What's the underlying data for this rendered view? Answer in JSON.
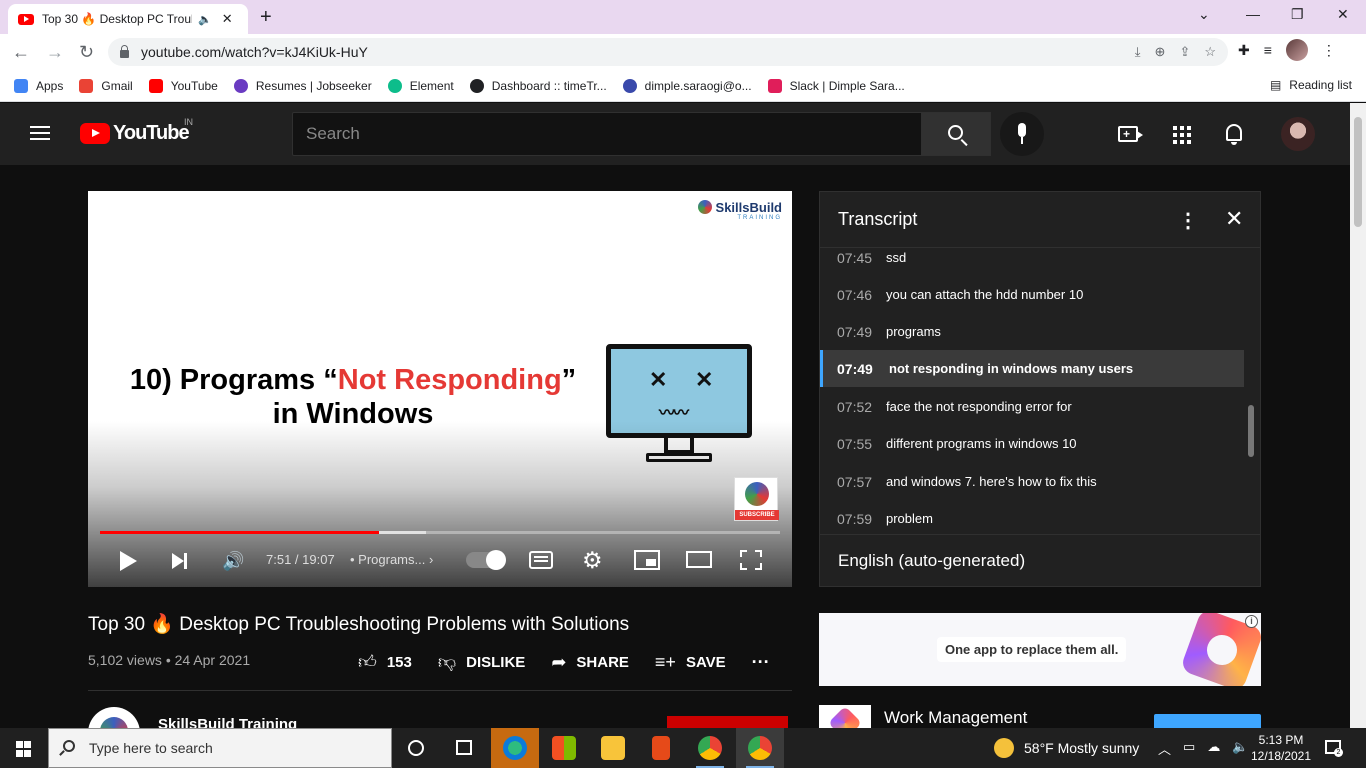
{
  "browser": {
    "tab_title": "Top 30 🔥 Desktop PC Troubl",
    "url": "youtube.com/watch?v=kJ4KiUk-HuY",
    "bookmarks": [
      {
        "label": "Apps",
        "color": "#4285f4"
      },
      {
        "label": "Gmail",
        "color": "#ea4335"
      },
      {
        "label": "YouTube",
        "color": "#ff0000"
      },
      {
        "label": "Resumes | Jobseeker",
        "color": "#6a3bc2"
      },
      {
        "label": "Element",
        "color": "#0dbd8b"
      },
      {
        "label": "Dashboard :: timeTr...",
        "color": "#202124"
      },
      {
        "label": "dimple.saraogi@o...",
        "color": "#3949ab"
      },
      {
        "label": "Slack | Dimple Sara...",
        "color": "#e01e5a"
      }
    ],
    "reading_list": "Reading list"
  },
  "youtube": {
    "logo_text": "YouTube",
    "country": "IN",
    "search_placeholder": "Search"
  },
  "player": {
    "brand_name": "SkillsBuild",
    "brand_sub": "TRAINING",
    "slide_prefix": "10)  Programs “",
    "slide_red": "Not Responding",
    "slide_suffix": "”",
    "slide_line2": "in Windows",
    "subscribe_label": "SUBSCRIBE",
    "time": "7:51 / 19:07",
    "chapter": "• Programs...",
    "progress_played": 0.41,
    "progress_loaded": 0.48
  },
  "video": {
    "title": "Top 30 🔥 Desktop PC Troubleshooting Problems with Solutions",
    "meta": "5,102 views • 24 Apr 2021",
    "likes": "153",
    "dislike": "DISLIKE",
    "share": "SHARE",
    "save": "SAVE",
    "channel": "SkillsBuild Training"
  },
  "transcript": {
    "title": "Transcript",
    "language": "English (auto-generated)",
    "segments": [
      {
        "time": "07:45",
        "text": "ssd"
      },
      {
        "time": "07:46",
        "text": "you can attach the hdd number 10"
      },
      {
        "time": "07:49",
        "text": "programs"
      },
      {
        "time": "07:49",
        "text": "not responding in windows many users"
      },
      {
        "time": "07:52",
        "text": "face the not responding error for"
      },
      {
        "time": "07:55",
        "text": "different programs in windows 10"
      },
      {
        "time": "07:57",
        "text": "and windows 7. here's how to fix this"
      },
      {
        "time": "07:59",
        "text": "problem"
      }
    ]
  },
  "ad": {
    "tagline": "One app to replace them all."
  },
  "related": {
    "title": "Work Management"
  },
  "taskbar": {
    "search_placeholder": "Type here to search",
    "weather": "58°F  Mostly sunny",
    "time": "5:13 PM",
    "date": "12/18/2021"
  }
}
